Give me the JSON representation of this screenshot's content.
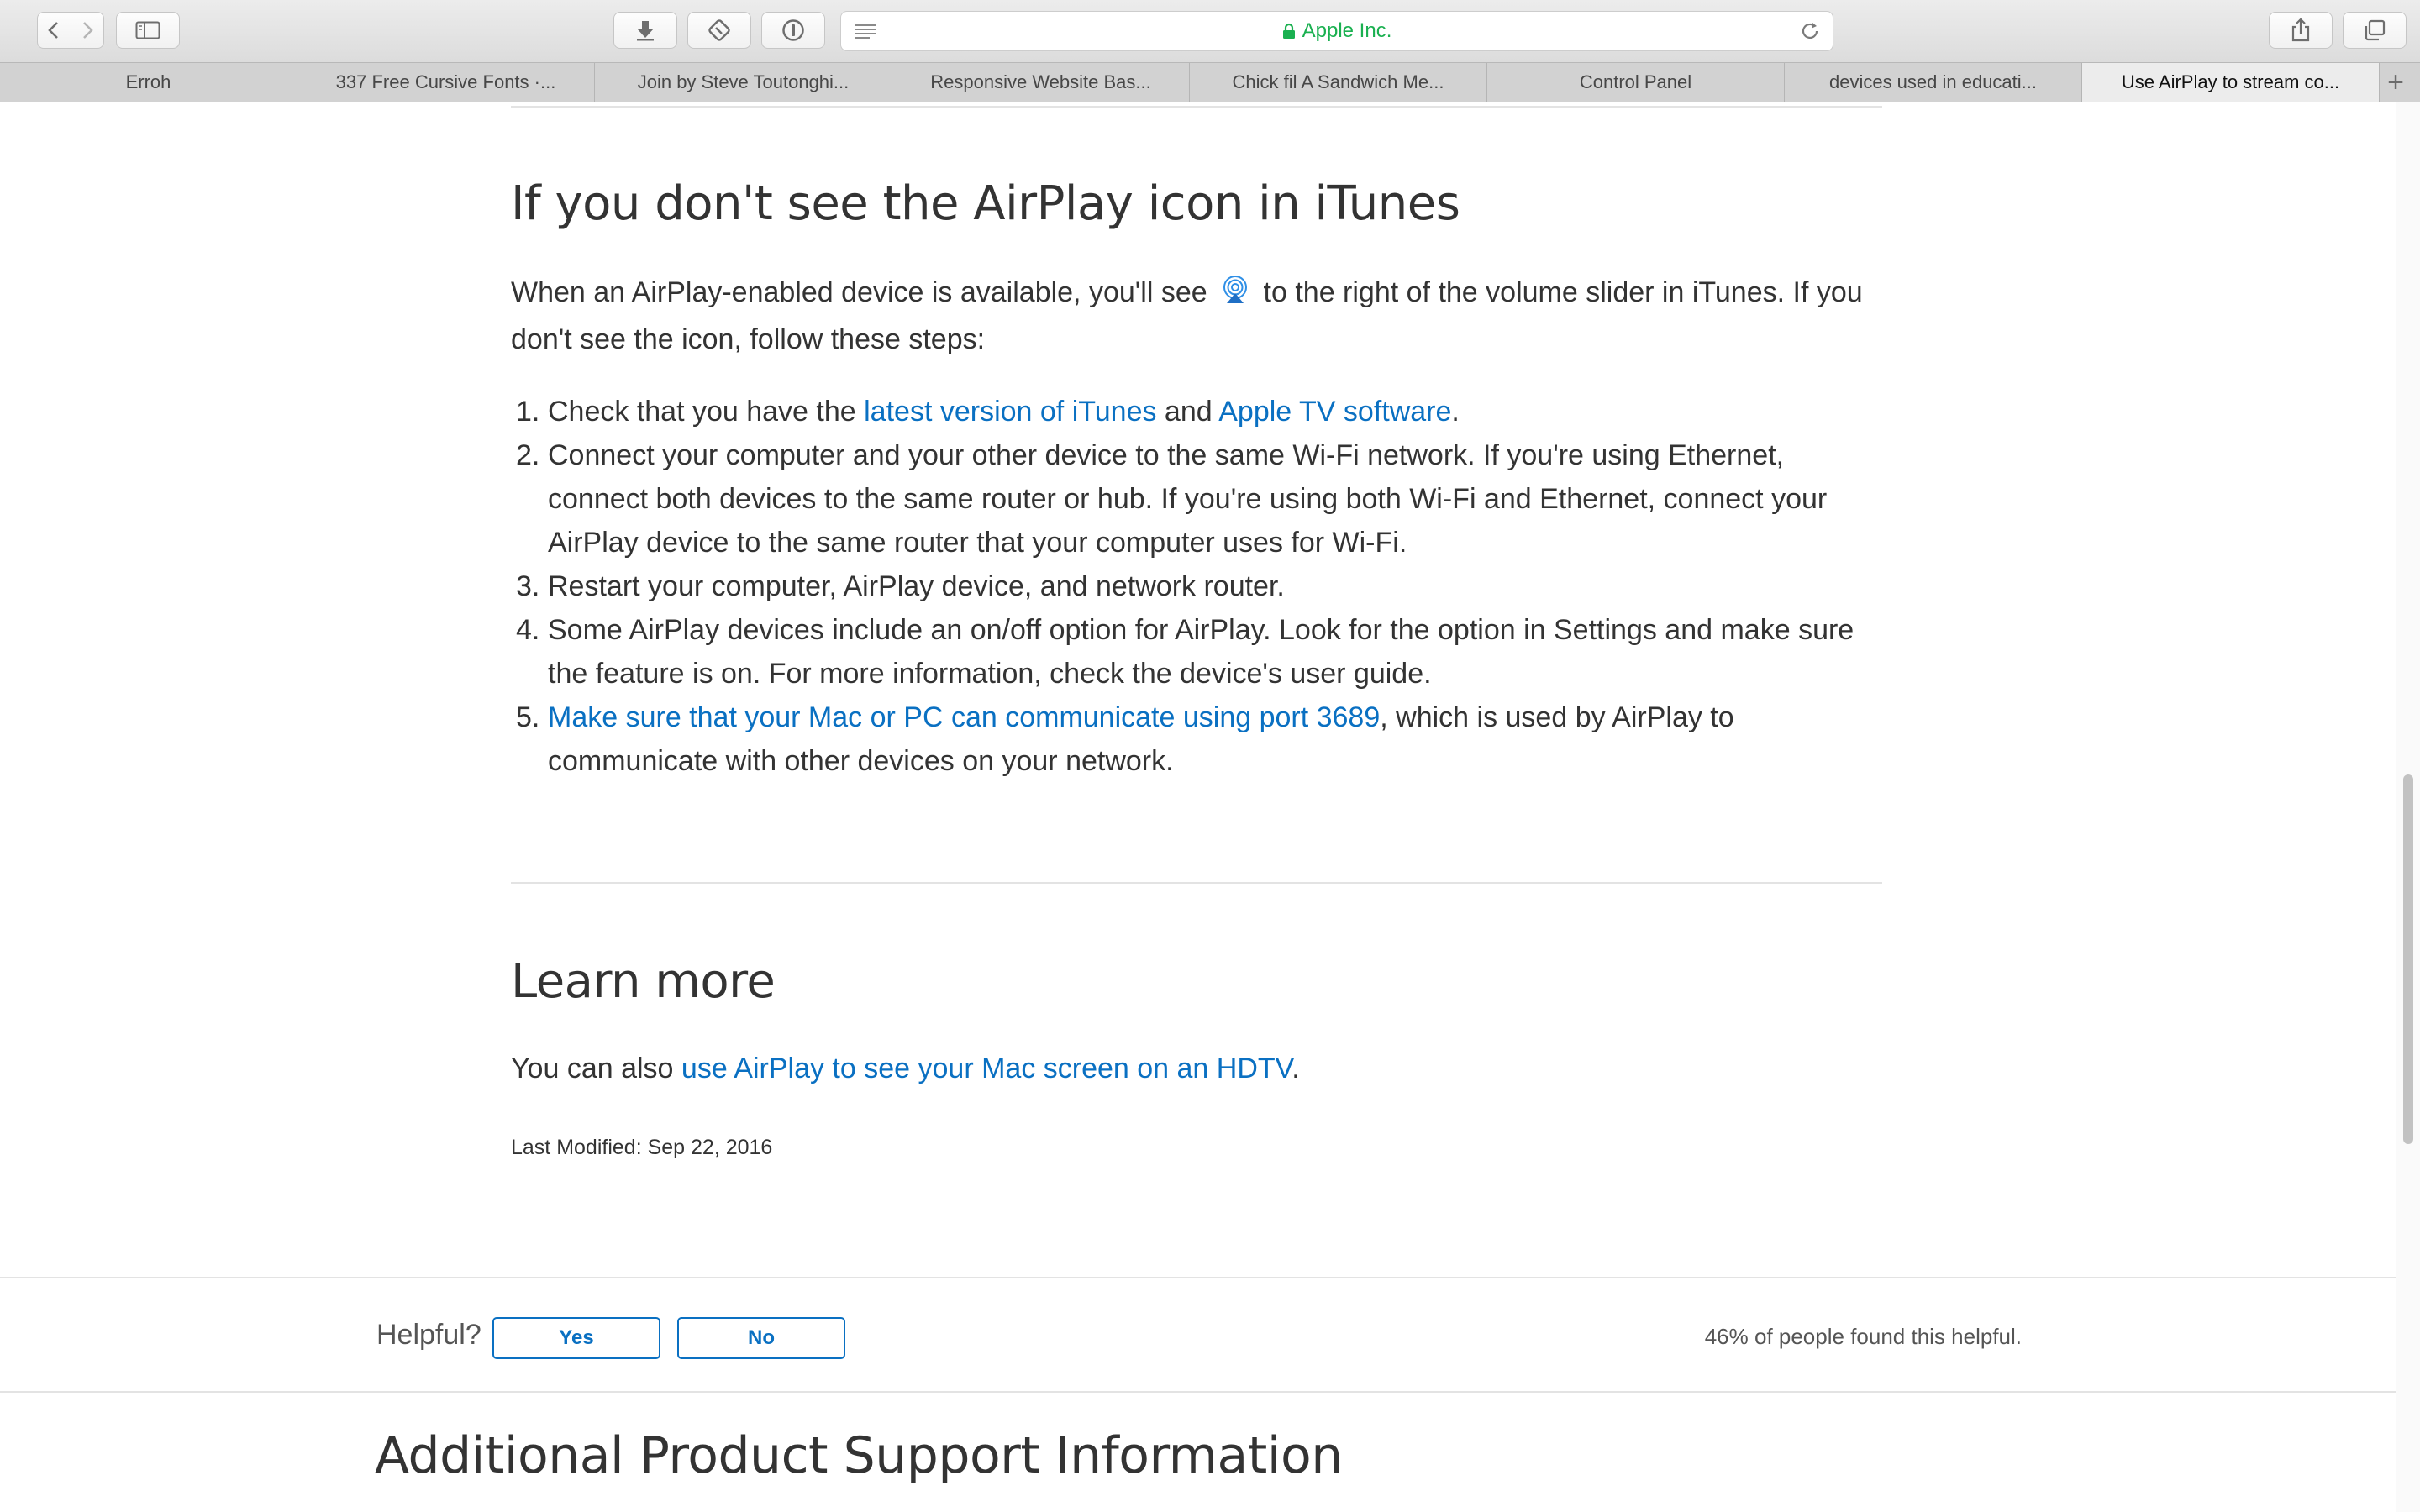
{
  "browser": {
    "host": "Apple Inc.",
    "tabs": [
      {
        "label": "Erroh",
        "active": false
      },
      {
        "label": "337 Free Cursive Fonts ·...",
        "active": false
      },
      {
        "label": "Join by Steve Toutonghi...",
        "active": false
      },
      {
        "label": "Responsive Website Bas...",
        "active": false
      },
      {
        "label": "Chick fil A Sandwich Me...",
        "active": false
      },
      {
        "label": "Control Panel",
        "active": false
      },
      {
        "label": "devices used in educati...",
        "active": false
      },
      {
        "label": "Use AirPlay to stream co...",
        "active": true
      }
    ],
    "new_tab": "+"
  },
  "section1": {
    "heading": "If you don't see the AirPlay icon in iTunes",
    "intro_before": "When an AirPlay-enabled device is available, you'll see",
    "intro_after": "to the right of the volume slider in iTunes. If you don't see the icon, follow these steps:",
    "steps": [
      {
        "num": "1.",
        "pre": "Check that you have the ",
        "link1": "latest version of iTunes",
        "mid": " and ",
        "link2": "Apple TV software",
        "post": "."
      },
      {
        "num": "2.",
        "text": "Connect your computer and your other device to the same Wi-Fi network. If you're using Ethernet, connect both devices to the same router or hub. If you're using both Wi-Fi and Ethernet, connect your AirPlay device to the same router that your computer uses for Wi-Fi."
      },
      {
        "num": "3.",
        "text": "Restart your computer, AirPlay device, and network router."
      },
      {
        "num": "4.",
        "text": "Some AirPlay devices include an on/off option for AirPlay. Look for the option in Settings and make sure the feature is on. For more information, check the device's user guide."
      },
      {
        "num": "5.",
        "link": "Make sure that your Mac or PC can communicate using port 3689",
        "post": ", which is used by AirPlay to communicate with other devices on your network."
      }
    ]
  },
  "learn_more": {
    "heading": "Learn more",
    "pre": "You can also ",
    "link": "use AirPlay to see your Mac screen on an HDTV",
    "post": ".",
    "last_modified": "Last Modified: Sep 22, 2016"
  },
  "feedback": {
    "label": "Helpful?",
    "yes": "Yes",
    "no": "No",
    "stat": "46% of people found this helpful."
  },
  "additional": {
    "heading": "Additional Product Support Information"
  },
  "colors": {
    "link": "#0a70c2",
    "secure_host": "#1ab050"
  },
  "icons": [
    "back-icon",
    "forward-icon",
    "sidebar-icon",
    "downloads-icon",
    "extension-icon",
    "info-icon",
    "reader-icon",
    "lock-icon",
    "reload-icon",
    "share-icon",
    "tabs-icon",
    "airplay-icon"
  ]
}
